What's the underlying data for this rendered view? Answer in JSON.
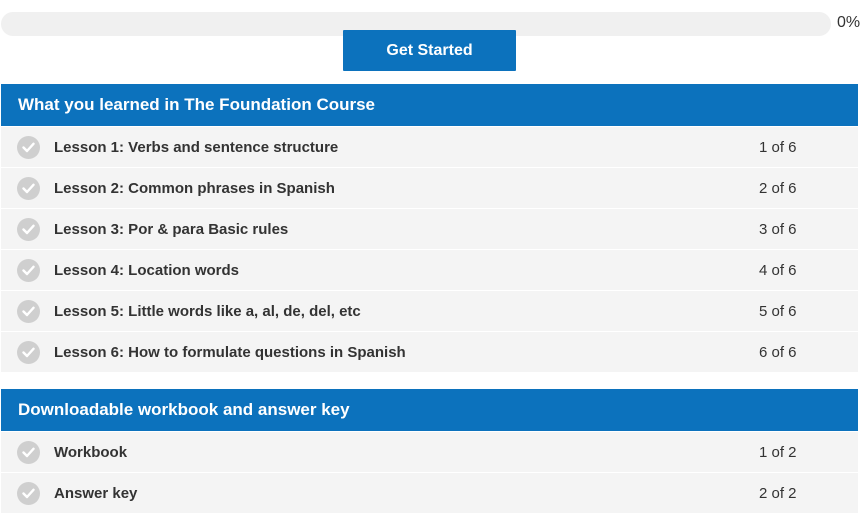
{
  "progress": {
    "percent_value": 0,
    "label": "0%"
  },
  "start_button": {
    "label": "Get Started"
  },
  "sections": [
    {
      "title": "What you learned in The Foundation Course",
      "items": [
        {
          "title": "Lesson 1: Verbs and sentence structure",
          "count": "1 of 6"
        },
        {
          "title": "Lesson 2: Common phrases in Spanish",
          "count": "2 of 6"
        },
        {
          "title": "Lesson 3: Por & para Basic rules",
          "count": "3 of 6"
        },
        {
          "title": "Lesson 4: Location words",
          "count": "4 of 6"
        },
        {
          "title": "Lesson 5: Little words like a, al, de, del, etc",
          "count": "5 of 6"
        },
        {
          "title": "Lesson 6: How to formulate questions in Spanish",
          "count": "6 of 6"
        }
      ]
    },
    {
      "title": "Downloadable workbook and answer key",
      "items": [
        {
          "title": "Workbook",
          "count": "1 of 2"
        },
        {
          "title": "Answer key",
          "count": "2 of 2"
        }
      ]
    }
  ],
  "colors": {
    "accent": "#0c72bd",
    "row_bg": "#f4f4f4",
    "check_bg": "#cfcfcf"
  },
  "icons": {
    "row_status": "checkmark-circle-icon"
  }
}
